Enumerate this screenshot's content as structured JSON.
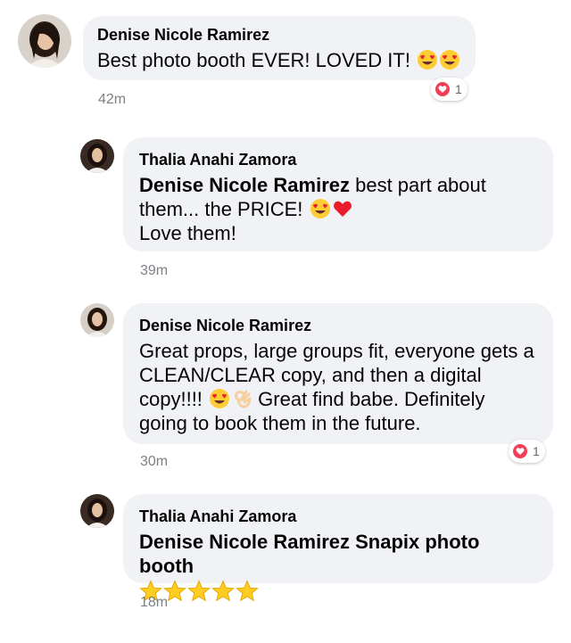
{
  "comments": [
    {
      "author": "Denise Nicole Ramirez",
      "text": "Best photo booth EVER! LOVED IT!",
      "emoji": [
        "heart-eyes",
        "heart-eyes"
      ],
      "time": "42m",
      "reaction_count": "1"
    },
    {
      "author": "Thalia Anahi Zamora",
      "mention": "Denise Nicole Ramirez",
      "text_line1": " best part about",
      "text_line2": "them... the PRICE! ",
      "emoji": [
        "heart-eyes",
        "red-heart"
      ],
      "text_line3": "Love them!",
      "time": "39m"
    },
    {
      "author": "Denise Nicole Ramirez",
      "line1": "Great props, large groups fit, everyone gets a",
      "line2": "CLEAN/CLEAR copy, and then a digital",
      "line3_start": "copy!!!! ",
      "emoji": [
        "heart-eyes",
        "ok-hand"
      ],
      "line3_end": " Great find babe. Definitely",
      "line4": "going to book them in the future.",
      "time": "30m",
      "reaction_count": "1"
    },
    {
      "author": "Thalia Anahi Zamora",
      "mention": "Denise Nicole Ramirez",
      "text": " Snapix photo booth",
      "stars": 5,
      "time": "18m"
    }
  ],
  "colors": {
    "bubble": "#f0f2f5",
    "timestamp": "#7d8085",
    "reaction": "#f33e58"
  }
}
